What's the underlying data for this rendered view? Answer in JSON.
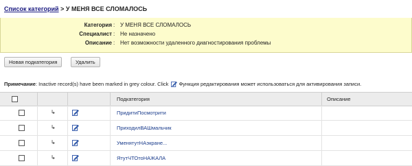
{
  "breadcrumb": {
    "link": "Список категорий",
    "separator": ">",
    "current": "У МЕНЯ ВСЕ СЛОМАЛОСЬ"
  },
  "info": {
    "category_label": "Категория",
    "category_value": "У МЕНЯ ВСЕ СЛОМАЛОСЬ",
    "specialist_label": "Специалист",
    "specialist_value": "Не назначено",
    "description_label": "Описание",
    "description_value": "Нет возможности удаленного диагностирования проблемы",
    "colon": ":"
  },
  "toolbar": {
    "new_subcategory_label": "Новая подкатегория",
    "delete_label": "Удалить"
  },
  "note": {
    "label": "Примечание",
    "text_before": ": Inactive record(s) have been marked in grey colour. Click",
    "text_after": "Функция редактирования может использоваться для активирования записи."
  },
  "table": {
    "columns": [
      "Подкатегория",
      "Описание"
    ],
    "rows": [
      {
        "name": "ПридитиПосмотрити",
        "description": ""
      },
      {
        "name": "ПриходилВАШмальчик",
        "description": ""
      },
      {
        "name": "УменятутНАэкране...",
        "description": ""
      },
      {
        "name": "ЯтутЧТОтоНАЖАЛА",
        "description": ""
      }
    ]
  },
  "icons": {
    "row_arrow": "subcategory-arrow-icon",
    "edit": "edit-pencil-icon"
  },
  "colors": {
    "info_background": "#fdfccc",
    "link": "#1a3c8c",
    "header_background": "#ececec"
  }
}
